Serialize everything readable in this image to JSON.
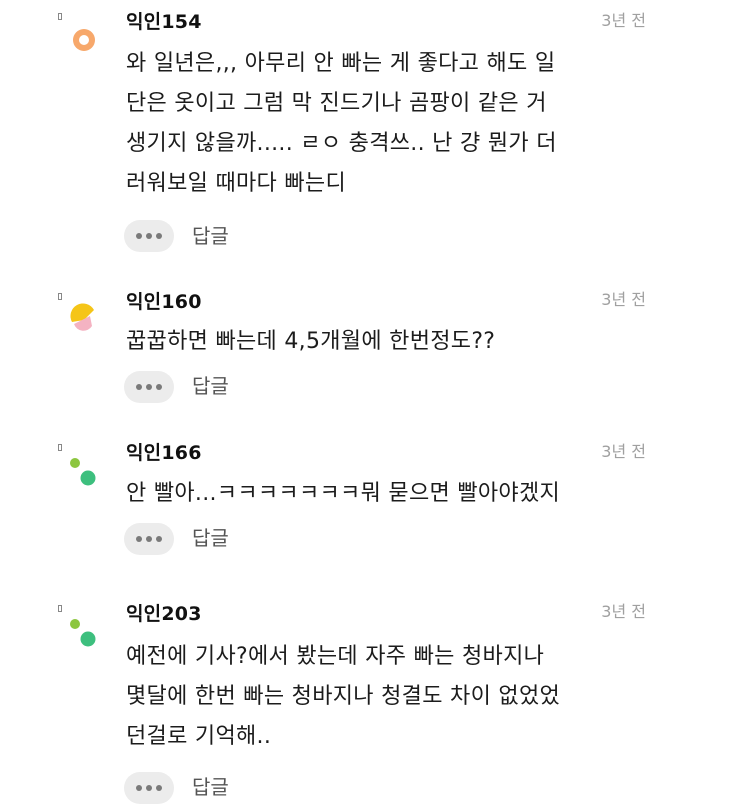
{
  "comments": [
    {
      "author": "익인154",
      "time": "3년 전",
      "text": "와 일년은,,, 아무리 안 빠는 게 좋다고 해도 일\n단은 옷이고 그럼 막 진드기나 곰팡이 같은 거\n생기지 않을까..... ㄹㅇ 충격쓰.. 난 걍 뭔가 더\n러워보일 때마다 빠는디",
      "reply_label": "답글",
      "avatar_icon": "orange-ring-avatar-icon"
    },
    {
      "author": "익인160",
      "time": "3년 전",
      "text": "꿉꿉하면 빠는데 4,5개월에 한번정도??",
      "reply_label": "답글",
      "avatar_icon": "yellow-pink-shapes-avatar-icon"
    },
    {
      "author": "익인166",
      "time": "3년 전",
      "text": "안 빨아...ㅋㅋㅋㅋㅋㅋㅋ뭐 묻으면 빨아야겠지",
      "reply_label": "답글",
      "avatar_icon": "green-dots-avatar-icon"
    },
    {
      "author": "익인203",
      "time": "3년 전",
      "text": "예전에 기사?에서 봤는데 자주 빠는 청바지나\n몇달에 한번 빠는 청바지나 청결도 차이 없었었\n던걸로 기억해..",
      "reply_label": "답글",
      "avatar_icon": "green-dots-avatar-icon"
    }
  ],
  "colors": {
    "author": "#111111",
    "time": "#a0a0a0",
    "more_button_bg": "#ececec",
    "avatar_orange": "#f7a86b",
    "avatar_yellow": "#f5c518",
    "avatar_pink": "#f4b3c2",
    "avatar_green_light": "#8cc63f",
    "avatar_green_dark": "#3dbf7e"
  }
}
